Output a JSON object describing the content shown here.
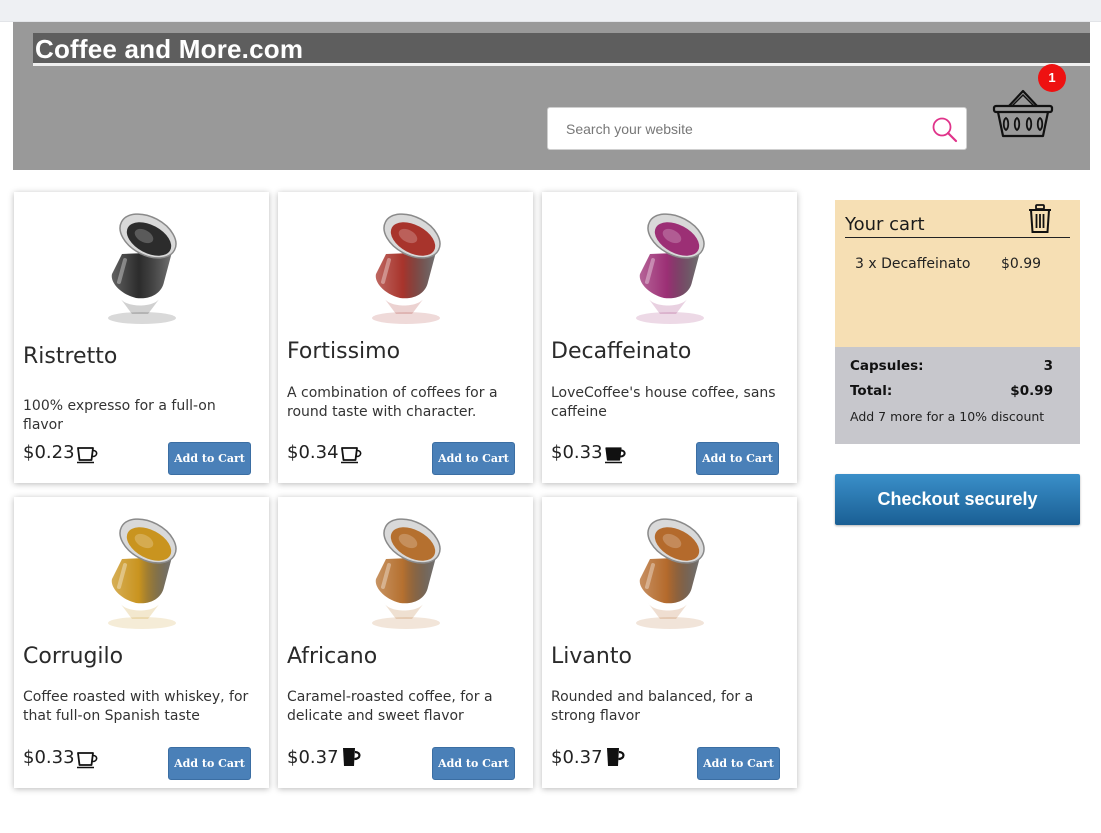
{
  "header": {
    "site_title": "Coffee and More.com",
    "search_placeholder": "Search your website",
    "cart_badge_count": "1"
  },
  "products": [
    {
      "name": "Ristretto",
      "description": "100% expresso for a full-on flavor",
      "price": "$0.23",
      "cup_icon": "cup-outline-icon",
      "color": "#2c2c2c",
      "add_label": "Add to Cart"
    },
    {
      "name": "Fortissimo",
      "description": "A combination of coffees for a round taste with character.",
      "price": "$0.34",
      "cup_icon": "cup-outline-icon",
      "color": "#a8342c",
      "add_label": "Add to Cart"
    },
    {
      "name": "Decaffeinato",
      "description": "LoveCoffee's house coffee, sans caffeine",
      "price": "$0.33",
      "cup_icon": "cup-filled-icon",
      "color": "#9c2f75",
      "add_label": "Add to Cart"
    },
    {
      "name": "Corrugilo",
      "description": "Coffee roasted with whiskey, for that full-on Spanish taste",
      "price": "$0.33",
      "cup_icon": "cup-outline-icon",
      "color": "#c9941f",
      "add_label": "Add to Cart"
    },
    {
      "name": "Africano",
      "description": "Caramel-roasted coffee, for a delicate and sweet flavor",
      "price": "$0.37",
      "cup_icon": "mug-filled-icon",
      "color": "#b5702f",
      "add_label": "Add to Cart"
    },
    {
      "name": "Livanto",
      "description": "Rounded and balanced, for a strong flavor",
      "price": "$0.37",
      "cup_icon": "mug-filled-icon",
      "color": "#b46a2c",
      "add_label": "Add to Cart"
    }
  ],
  "cart": {
    "title": "Your cart",
    "item_name": "3 x Decaffeinato",
    "item_price": "$0.99",
    "capsules_label": "Capsules:",
    "capsules_value": "3",
    "total_label": "Total:",
    "total_value": "$0.99",
    "discount_note": "Add 7 more for a 10% discount"
  },
  "checkout_label": "Checkout securely",
  "colors": {
    "header_bg": "#999999",
    "title_bar": "#5e5e5e",
    "add_button": "#4a80b8",
    "cart_top": "#f6dfb4",
    "cart_bottom": "#c7c7cc",
    "checkout": "#1f6aa1",
    "badge": "#ee1111"
  }
}
